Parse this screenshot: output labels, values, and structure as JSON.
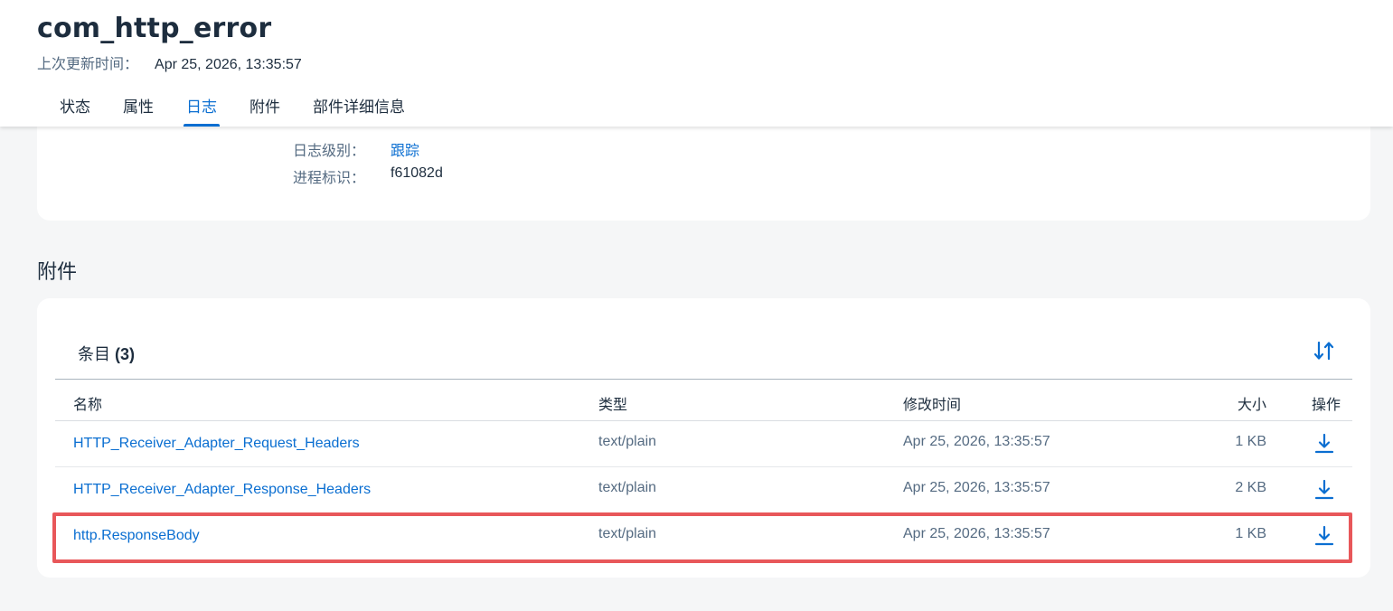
{
  "header": {
    "title": "com_http_error",
    "last_updated_label": "上次更新时间：",
    "last_updated_value": "Apr 25, 2026, 13:35:57",
    "tabs": [
      {
        "label": "状态",
        "active": false
      },
      {
        "label": "属性",
        "active": false
      },
      {
        "label": "日志",
        "active": true
      },
      {
        "label": "附件",
        "active": false
      },
      {
        "label": "部件详细信息",
        "active": false
      }
    ]
  },
  "log": {
    "level_label": "日志级别：",
    "level_value": "跟踪",
    "process_label": "进程标识：",
    "process_value": "f61082d"
  },
  "attachments": {
    "section_title": "附件",
    "toolbar_label": "条目",
    "toolbar_count": "(3)",
    "columns": {
      "name": "名称",
      "type": "类型",
      "modified": "修改时间",
      "size": "大小",
      "actions": "操作"
    },
    "rows": [
      {
        "name": "HTTP_Receiver_Adapter_Request_Headers",
        "type": "text/plain",
        "modified": "Apr 25, 2026, 13:35:57",
        "size": "1 KB"
      },
      {
        "name": "HTTP_Receiver_Adapter_Response_Headers",
        "type": "text/plain",
        "modified": "Apr 25, 2026, 13:35:57",
        "size": "2 KB"
      },
      {
        "name": "http.ResponseBody",
        "type": "text/plain",
        "modified": "Apr 25, 2026, 13:35:57",
        "size": "1 KB"
      }
    ],
    "highlighted_row": 2
  },
  "icons": {
    "sort": "sort-icon",
    "download": "download-icon"
  },
  "colors": {
    "accent": "#0a6ed1",
    "highlight": "#e8575a",
    "text": "#1d2d3e",
    "muted_text": "#556b82",
    "background": "#f5f6f7"
  }
}
